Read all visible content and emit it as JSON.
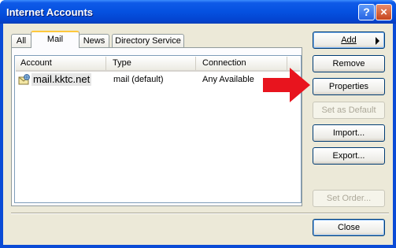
{
  "window": {
    "title": "Internet Accounts",
    "help_glyph": "?",
    "close_glyph": "×"
  },
  "tabs": [
    {
      "label": "All"
    },
    {
      "label": "Mail"
    },
    {
      "label": "News"
    },
    {
      "label": "Directory Service"
    }
  ],
  "list": {
    "columns": [
      "Account",
      "Type",
      "Connection"
    ],
    "rows": [
      {
        "account": "mail.kktc.net",
        "type": "mail (default)",
        "connection": "Any Available"
      }
    ]
  },
  "buttons": {
    "add": "Add",
    "remove": "Remove",
    "properties": "Properties",
    "set_default": "Set as Default",
    "import": "Import...",
    "export": "Export...",
    "set_order": "Set Order...",
    "close": "Close"
  },
  "colors": {
    "titlebar": "#0551e0",
    "annotation_arrow": "#e8141e",
    "client": "#ece9d8"
  }
}
